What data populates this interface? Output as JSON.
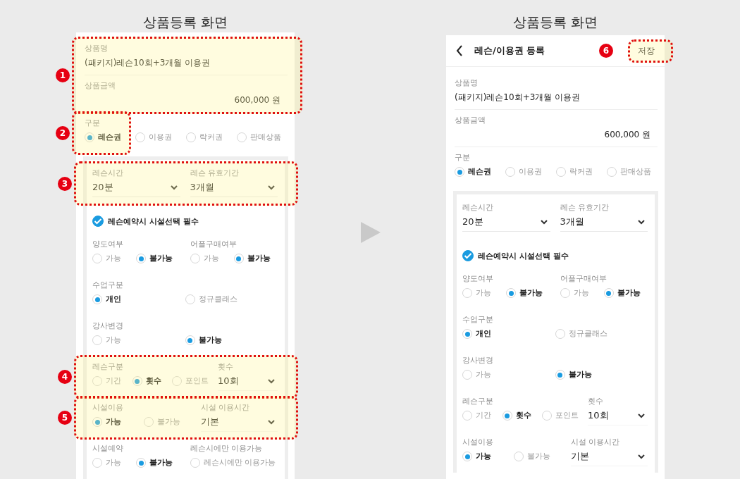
{
  "screens": [
    {
      "title": "상품등록 화면",
      "fields": [
        {
          "badge": "1",
          "first_option_only": false,
          "rows": [
            {
              "kind": "text",
              "label": "상품명",
              "value": "(패키지)레슨10회+3개월 이용권"
            },
            {
              "kind": "amount",
              "label": "상품금액",
              "value": "600,000 원"
            }
          ]
        },
        {
          "badge": "2",
          "first_option_only": true,
          "rows": [
            {
              "kind": "radio",
              "groups": [
                {
                  "label": "구분",
                  "options": [
                    {
                      "label": "레슨권",
                      "selected": true
                    },
                    {
                      "label": "이용권",
                      "selected": false
                    },
                    {
                      "label": "락커권",
                      "selected": false
                    },
                    {
                      "label": "판매상품",
                      "selected": false
                    }
                  ]
                }
              ]
            }
          ]
        }
      ],
      "card": [
        {
          "badge": "3",
          "first_option_only": false,
          "rows": [
            {
              "kind": "selects",
              "fields": [
                {
                  "label": "레슨시간",
                  "value": "20분"
                },
                {
                  "label": "레슨 유효기간",
                  "value": "3개월"
                }
              ]
            }
          ]
        },
        {
          "rows": [
            {
              "kind": "checkbox",
              "label": "레슨예약시 시설선택 필수",
              "checked": true
            },
            {
              "kind": "radio",
              "groups": [
                {
                  "label": "양도여부",
                  "options": [
                    {
                      "label": "가능",
                      "selected": false
                    },
                    {
                      "label": "불가능",
                      "selected": true
                    }
                  ]
                },
                {
                  "label": "어플구매여부",
                  "options": [
                    {
                      "label": "가능",
                      "selected": false
                    },
                    {
                      "label": "불가능",
                      "selected": true
                    }
                  ]
                }
              ]
            },
            {
              "kind": "radio",
              "groups": [
                {
                  "label": "수업구분",
                  "options": [
                    {
                      "label": "개인",
                      "selected": true
                    },
                    {
                      "label": "정규클래스",
                      "selected": false
                    }
                  ]
                }
              ]
            },
            {
              "kind": "radio",
              "groups": [
                {
                  "label": "강사변경",
                  "options": [
                    {
                      "label": "가능",
                      "selected": false
                    },
                    {
                      "label": "불가능",
                      "selected": true
                    }
                  ]
                }
              ]
            }
          ]
        },
        {
          "badge": "4",
          "first_option_only": false,
          "rows": [
            {
              "kind": "radio_select",
              "groups": [
                {
                  "label": "레슨구분",
                  "options": [
                    {
                      "label": "기간",
                      "selected": false
                    },
                    {
                      "label": "횟수",
                      "selected": true
                    },
                    {
                      "label": "포인트",
                      "selected": false
                    }
                  ]
                }
              ],
              "field": {
                "label": "횟수",
                "value": "10회"
              }
            }
          ]
        },
        {
          "badge": "5",
          "first_option_only": false,
          "rows": [
            {
              "kind": "radio_select",
              "groups": [
                {
                  "label": "시설이용",
                  "options": [
                    {
                      "label": "가능",
                      "selected": true
                    },
                    {
                      "label": "불가능",
                      "selected": false
                    }
                  ]
                }
              ],
              "field": {
                "label": "시설 이용시간",
                "value": "기본"
              }
            }
          ]
        },
        {
          "rows": [
            {
              "kind": "radio",
              "groups": [
                {
                  "label": "시설예약",
                  "options": [
                    {
                      "label": "가능",
                      "selected": false
                    },
                    {
                      "label": "불가능",
                      "selected": true
                    }
                  ]
                },
                {
                  "label": "레슨시에만 이용가능",
                  "options": [
                    {
                      "label": "레슨시에만 이용가능",
                      "selected": false
                    }
                  ]
                }
              ]
            }
          ]
        }
      ]
    },
    {
      "title": "상품등록 화면",
      "header": {
        "title": "레슨/이용권 등록",
        "save": {
          "label": "저장",
          "badge": "6"
        }
      },
      "fields": [
        {
          "rows": [
            {
              "kind": "text",
              "label": "상품명",
              "value": "(패키지)레슨10회+3개월 이용권"
            },
            {
              "kind": "amount",
              "label": "상품금액",
              "value": "600,000 원"
            }
          ]
        },
        {
          "rows": [
            {
              "kind": "radio",
              "groups": [
                {
                  "label": "구분",
                  "options": [
                    {
                      "label": "레슨권",
                      "selected": true
                    },
                    {
                      "label": "이용권",
                      "selected": false
                    },
                    {
                      "label": "락커권",
                      "selected": false
                    },
                    {
                      "label": "판매상품",
                      "selected": false
                    }
                  ]
                }
              ]
            }
          ]
        }
      ],
      "card": [
        {
          "rows": [
            {
              "kind": "selects",
              "fields": [
                {
                  "label": "레슨시간",
                  "value": "20분"
                },
                {
                  "label": "레슨 유효기간",
                  "value": "3개월"
                }
              ]
            }
          ]
        },
        {
          "rows": [
            {
              "kind": "checkbox",
              "label": "레슨예약시 시설선택 필수",
              "checked": true
            },
            {
              "kind": "radio",
              "groups": [
                {
                  "label": "양도여부",
                  "options": [
                    {
                      "label": "가능",
                      "selected": false
                    },
                    {
                      "label": "불가능",
                      "selected": true
                    }
                  ]
                },
                {
                  "label": "어플구매여부",
                  "options": [
                    {
                      "label": "가능",
                      "selected": false
                    },
                    {
                      "label": "불가능",
                      "selected": true
                    }
                  ]
                }
              ]
            },
            {
              "kind": "radio",
              "groups": [
                {
                  "label": "수업구분",
                  "options": [
                    {
                      "label": "개인",
                      "selected": true
                    },
                    {
                      "label": "정규클래스",
                      "selected": false
                    }
                  ]
                }
              ]
            },
            {
              "kind": "radio",
              "groups": [
                {
                  "label": "강사변경",
                  "options": [
                    {
                      "label": "가능",
                      "selected": false
                    },
                    {
                      "label": "불가능",
                      "selected": true
                    }
                  ]
                }
              ]
            }
          ]
        },
        {
          "rows": [
            {
              "kind": "radio_select",
              "groups": [
                {
                  "label": "레슨구분",
                  "options": [
                    {
                      "label": "기간",
                      "selected": false
                    },
                    {
                      "label": "횟수",
                      "selected": true
                    },
                    {
                      "label": "포인트",
                      "selected": false
                    }
                  ]
                }
              ],
              "field": {
                "label": "횟수",
                "value": "10회"
              }
            }
          ]
        },
        {
          "rows": [
            {
              "kind": "radio_select",
              "groups": [
                {
                  "label": "시설이용",
                  "options": [
                    {
                      "label": "가능",
                      "selected": true
                    },
                    {
                      "label": "불가능",
                      "selected": false
                    }
                  ]
                }
              ],
              "field": {
                "label": "시설 이용시간",
                "value": "기본"
              }
            }
          ]
        }
      ]
    }
  ]
}
